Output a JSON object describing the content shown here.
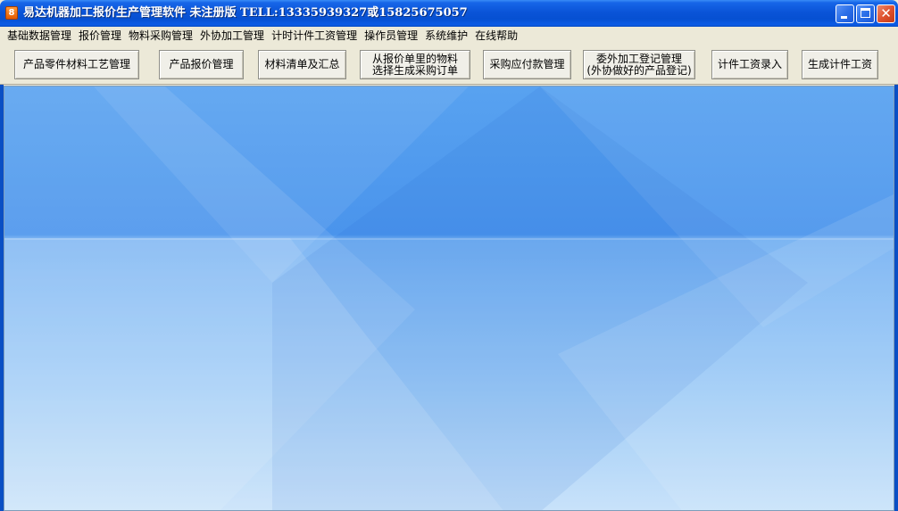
{
  "window": {
    "title": "易达机器加工报价生产管理软件 未注册版 TELL:13335939327或15825675057",
    "icon_glyph": "8",
    "controls": [
      "minimize-icon",
      "maximize-icon",
      "close-icon"
    ]
  },
  "menu": {
    "items": [
      {
        "label": "基础数据管理"
      },
      {
        "label": "报价管理"
      },
      {
        "label": "物料采购管理"
      },
      {
        "label": "外协加工管理"
      },
      {
        "label": "计时计件工资管理"
      },
      {
        "label": "操作员管理"
      },
      {
        "label": "系统维护"
      },
      {
        "label": "在线帮助"
      }
    ]
  },
  "toolbar": {
    "buttons": [
      {
        "label": "产品零件材料工艺管理"
      },
      {
        "label": "产品报价管理"
      },
      {
        "label": "材料清单及汇总"
      },
      {
        "label": "从报价单里的物料\n选择生成采购订单"
      },
      {
        "label": "采购应付款管理"
      },
      {
        "label": "委外加工登记管理\n(外协做好的产品登记)"
      },
      {
        "label": "计件工资录入"
      },
      {
        "label": "生成计件工资"
      }
    ]
  },
  "colors": {
    "titlebar": "#0a54d8",
    "background_top": "#58a2f0",
    "background_bottom": "#c8e2fa",
    "close_button": "#e0522f"
  }
}
